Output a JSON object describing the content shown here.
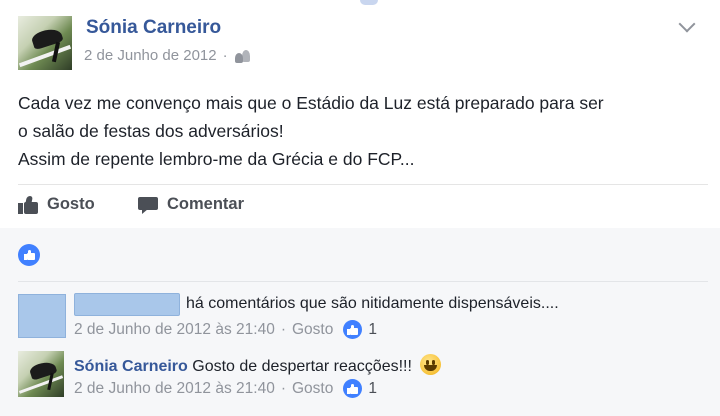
{
  "post": {
    "author": "Sónia Carneiro",
    "date": "2 de Junho de 2012",
    "meta_separator": "·",
    "audience_icon": "friends-icon",
    "text_lines": [
      "Cada vez me convenço mais que o Estádio da Luz está preparado para ser",
      "o salão de festas dos adversários!",
      "Assim de repente lembro-me da Grécia e do FCP..."
    ],
    "actions": {
      "like_label": "Gosto",
      "comment_label": "Comentar"
    }
  },
  "comments": [
    {
      "author": "",
      "text": "há comentários que são nitidamente dispensáveis....",
      "timestamp": "2 de Junho de 2012 às 21:40",
      "separator": "·",
      "like_label": "Gosto",
      "like_count": "1"
    },
    {
      "author": "Sónia Carneiro",
      "text": "Gosto de despertar reacções!!!",
      "emoji": "smiley-icon",
      "timestamp": "2 de Junho de 2012 às 21:40",
      "separator": "·",
      "like_label": "Gosto",
      "like_count": "1"
    }
  ],
  "colors": {
    "author_blue": "#365899",
    "meta_gray": "#90949c",
    "like_blue": "#4080ff",
    "comments_bg": "#f6f7f9"
  }
}
